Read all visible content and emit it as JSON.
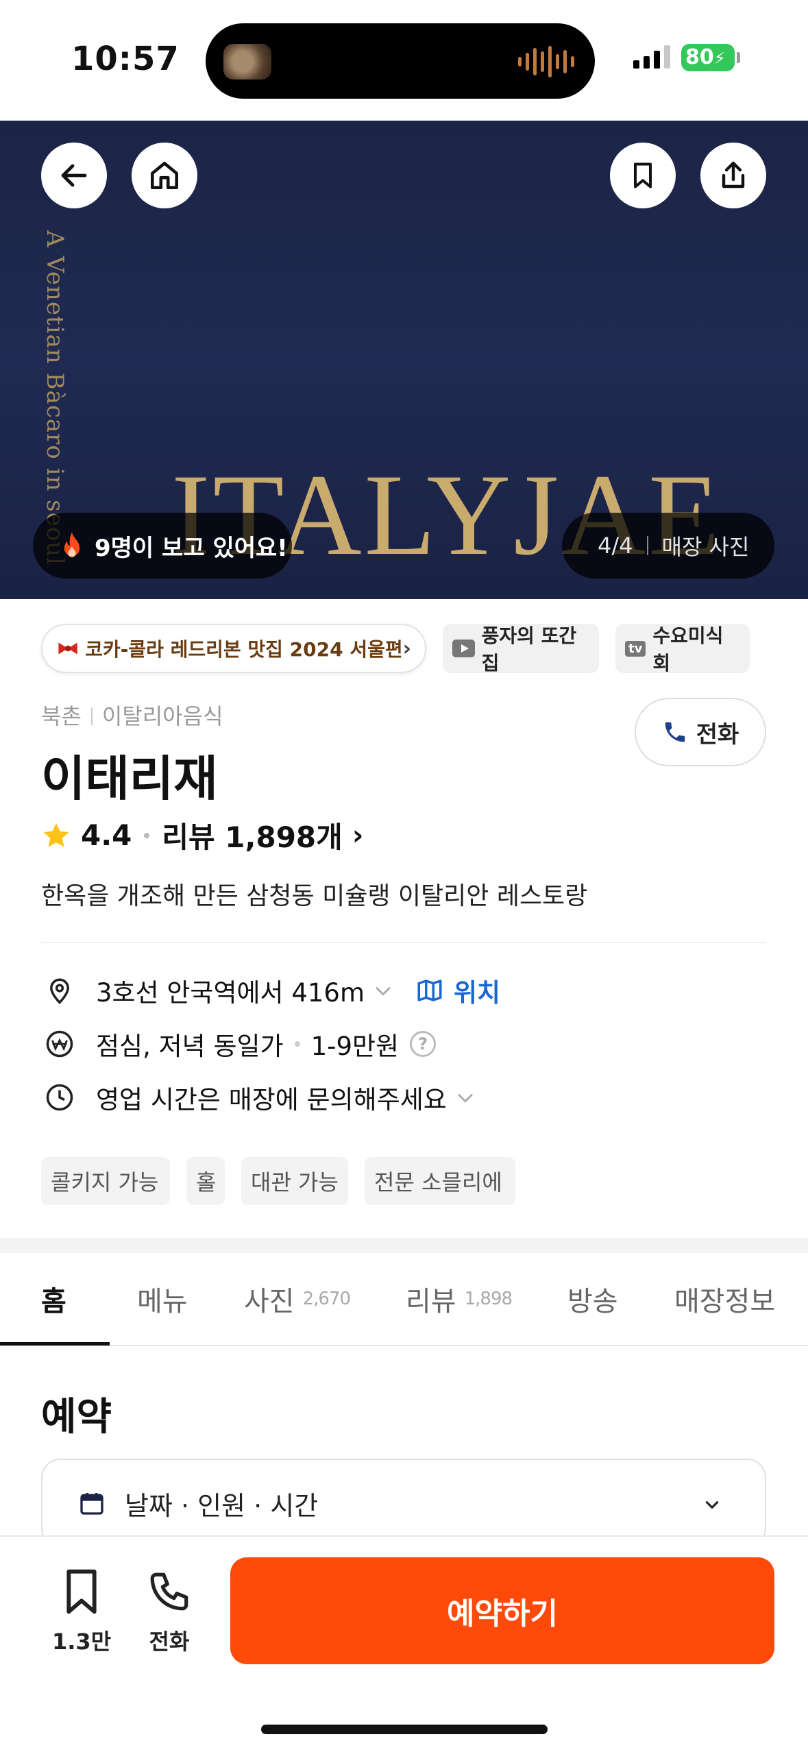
{
  "status_bar": {
    "time": "10:57",
    "battery": "80"
  },
  "hero": {
    "vertical_text": "A Venetian Bàcaro in seoul",
    "brand_text": "ITALYJAE",
    "viewers": "9명이 보고 있어요!",
    "photo_counter": "4/4",
    "photo_label": "매장 사진"
  },
  "badges": {
    "award": "코카-콜라 레드리본 맛집 2024 서울편",
    "youtube": "풍자의 또간집",
    "tv_tag": "tv",
    "tv": "수요미식회"
  },
  "place": {
    "area": "북촌",
    "category": "이탈리아음식",
    "call_label": "전화",
    "name": "이태리재",
    "rating": "4.4",
    "reviews": "리뷰 1,898개",
    "description": "한옥을 개조해 만든 삼청동 미슐랭 이탈리안 레스토랑"
  },
  "info": {
    "distance": "3호선 안국역에서 416m",
    "location_link": "위치",
    "price_type": "점심, 저녁 동일가",
    "price_range": "1-9만원",
    "hours": "영업 시간은 매장에 문의해주세요"
  },
  "tags": [
    "콜키지 가능",
    "홀",
    "대관 가능",
    "전문 소믈리에"
  ],
  "tabs": [
    {
      "label": "홈",
      "count": ""
    },
    {
      "label": "메뉴",
      "count": ""
    },
    {
      "label": "사진",
      "count": "2,670"
    },
    {
      "label": "리뷰",
      "count": "1,898"
    },
    {
      "label": "방송",
      "count": ""
    },
    {
      "label": "매장정보",
      "count": ""
    }
  ],
  "reservation": {
    "title": "예약",
    "selector_placeholder": "날짜 · 인원 · 시간"
  },
  "bottom_bar": {
    "save_count": "1.3만",
    "call_label": "전화",
    "reserve_label": "예약하기"
  },
  "colors": {
    "accent": "#ff4a0a",
    "link": "#1767d4",
    "hero_bg": "#1f2850",
    "star": "#ffc21a"
  }
}
